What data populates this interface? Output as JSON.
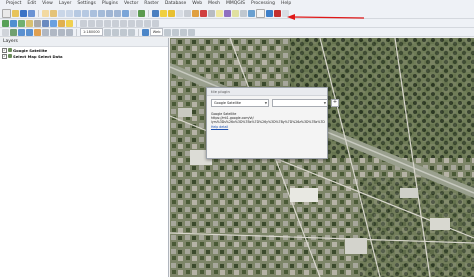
{
  "menubar": {
    "items": [
      "Project",
      "Edit",
      "View",
      "Layer",
      "Settings",
      "Plugins",
      "Vector",
      "Raster",
      "Database",
      "Web",
      "Mesh",
      "MMQGIS",
      "Processing",
      "Help"
    ]
  },
  "toolbar": {
    "scale_combo": "1:180000",
    "web_label": "Web"
  },
  "layers_panel": {
    "title": "Layers",
    "items": [
      {
        "label": "Google Satellite",
        "checked": true
      },
      {
        "label": "Select Map Select Data",
        "checked": true
      }
    ]
  },
  "plugin_dialog": {
    "title": "tile plugin",
    "service_select": "Google Satellite",
    "second_select": "",
    "add_label": "+",
    "info_name": "Google Satellite",
    "info_url": "https://mt1.google.com/vt/",
    "info_params": "lyrs%3Ds%26x%3D%7Bx%7D%26y%3D%7By%7D%26z%3D%7Bz%7D",
    "info_link": "Help detail"
  },
  "colors": {
    "annotation_arrow": "#e01818",
    "map_base": "#8a8e76"
  }
}
